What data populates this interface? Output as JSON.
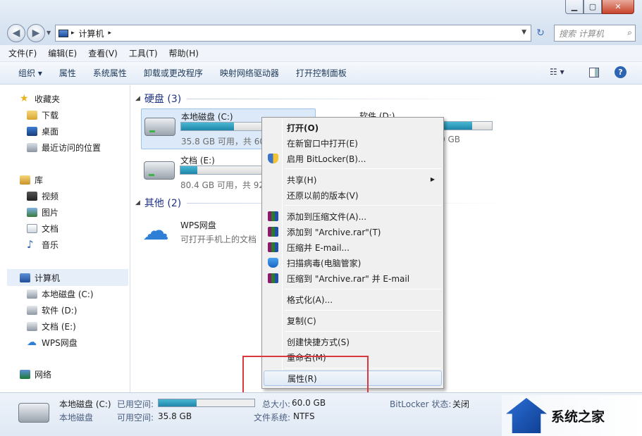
{
  "window": {
    "address": [
      "计算机"
    ],
    "search_placeholder": "搜索 计算机"
  },
  "menubar": [
    "文件(F)",
    "编辑(E)",
    "查看(V)",
    "工具(T)",
    "帮助(H)"
  ],
  "commands": [
    "组织 ▾",
    "属性",
    "系统属性",
    "卸载或更改程序",
    "映射网络驱动器",
    "打开控制面板"
  ],
  "nav": {
    "favorites": "收藏夹",
    "fav_items": [
      "下载",
      "桌面",
      "最近访问的位置"
    ],
    "library": "库",
    "lib_items": [
      "视频",
      "图片",
      "文档",
      "音乐"
    ],
    "computer": "计算机",
    "comp_items": [
      "本地磁盘 (C:)",
      "软件 (D:)",
      "文档 (E:)",
      "WPS网盘"
    ],
    "network": "网络"
  },
  "content": {
    "group_hdd": "硬盘 (3)",
    "group_other": "其他 (2)",
    "drives": [
      {
        "name": "本地磁盘 (C:)",
        "cap": "35.8 GB 可用，共 60",
        "fill": 0.4
      },
      {
        "name": "软件 (D:)",
        "cap": "0 GB",
        "fill": 0.85
      },
      {
        "name": "文档 (E:)",
        "cap": "80.4 GB 可用，共 92",
        "fill": 0.13
      }
    ],
    "wps": {
      "name": "WPS网盘",
      "desc": "可打开手机上的文档"
    }
  },
  "context_menu": {
    "open": "打开(O)",
    "open_new": "在新窗口中打开(E)",
    "bitlocker": "启用 BitLocker(B)...",
    "share": "共享(H)",
    "restore": "还原以前的版本(V)",
    "add_archive": "添加到压缩文件(A)...",
    "add_rar": "添加到 \"Archive.rar\"(T)",
    "compress_email": "压缩并 E-mail...",
    "scan": "扫描病毒(电脑管家)",
    "compress_rar_email": "压缩到 \"Archive.rar\" 并 E-mail",
    "format": "格式化(A)...",
    "copy": "复制(C)",
    "shortcut": "创建快捷方式(S)",
    "rename": "重命名(M)",
    "properties": "属性(R)"
  },
  "details": {
    "drive_name": "本地磁盘 (C:)",
    "drive_type": "本地磁盘",
    "used_label": "已用空间:",
    "free_label": "可用空间:",
    "free_value": "35.8 GB",
    "total_label": "总大小:",
    "total_value": "60.0 GB",
    "fs_label": "文件系统:",
    "fs_value": "NTFS",
    "bitlocker_label": "BitLocker 状态:",
    "bitlocker_value": "关闭",
    "used_fill": 0.4
  },
  "watermark": "系统之家"
}
